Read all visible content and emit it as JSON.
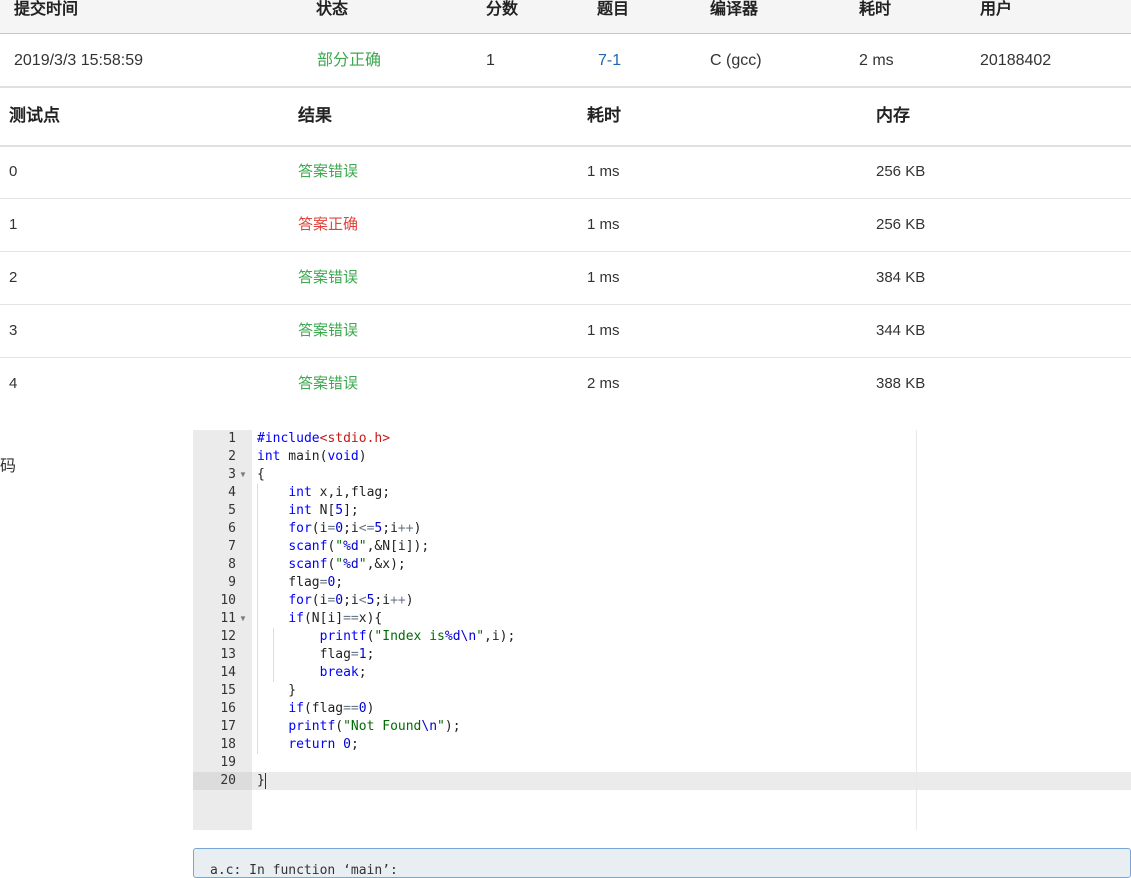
{
  "submission": {
    "headers": [
      "提交时间",
      "状态",
      "分数",
      "题目",
      "编译器",
      "耗时",
      "用户"
    ],
    "time": "2019/3/3 15:58:59",
    "status": "部分正确",
    "score": "1",
    "problem": "7-1",
    "compiler": "C (gcc)",
    "elapsed": "2 ms",
    "user": "20188402"
  },
  "testcases": {
    "headers": [
      "测试点",
      "结果",
      "耗时",
      "内存"
    ],
    "rows": [
      {
        "id": "0",
        "result": "答案错误",
        "result_color": "#3ca94f",
        "time": "1 ms",
        "memory": "256 KB"
      },
      {
        "id": "1",
        "result": "答案正确",
        "result_color": "#e0433b",
        "time": "1 ms",
        "memory": "256 KB"
      },
      {
        "id": "2",
        "result": "答案错误",
        "result_color": "#3ca94f",
        "time": "1 ms",
        "memory": "384 KB"
      },
      {
        "id": "3",
        "result": "答案错误",
        "result_color": "#3ca94f",
        "time": "1 ms",
        "memory": "344 KB"
      },
      {
        "id": "4",
        "result": "答案错误",
        "result_color": "#3ca94f",
        "time": "2 ms",
        "memory": "388 KB"
      }
    ]
  },
  "code_section": {
    "label": "代码",
    "lines": [
      "#include<stdio.h>",
      "int main(void)",
      "{",
      "  int x,i,flag;",
      "  int N[5];",
      "  for(i=0;i<=5;i++)",
      "  scanf(\"%d\",&N[i]);",
      "  scanf(\"%d\",&x);",
      "  flag=0;",
      "  for(i=0;i<5;i++)",
      "  if(N[i]==x){",
      "    printf(\"Index is%d\\n\",i);",
      "    flag=1;",
      "    break;",
      "  }",
      "  if(flag==0)",
      "  printf(\"Not Found\\n\");",
      "  return 0;",
      "",
      "}"
    ]
  },
  "compiler_output": {
    "text": "a.c: In function ‘main’:"
  },
  "colors": {
    "status_green": "#3ca94f",
    "status_red": "#e0433b",
    "link_blue": "#1f67b0",
    "keyword_blue": "#0000ff",
    "string_green": "#036a07",
    "include_red": "#c41a16",
    "number_blue": "#0000cd"
  },
  "icons": {
    "fold_marker": "fold-triangle-icon"
  }
}
